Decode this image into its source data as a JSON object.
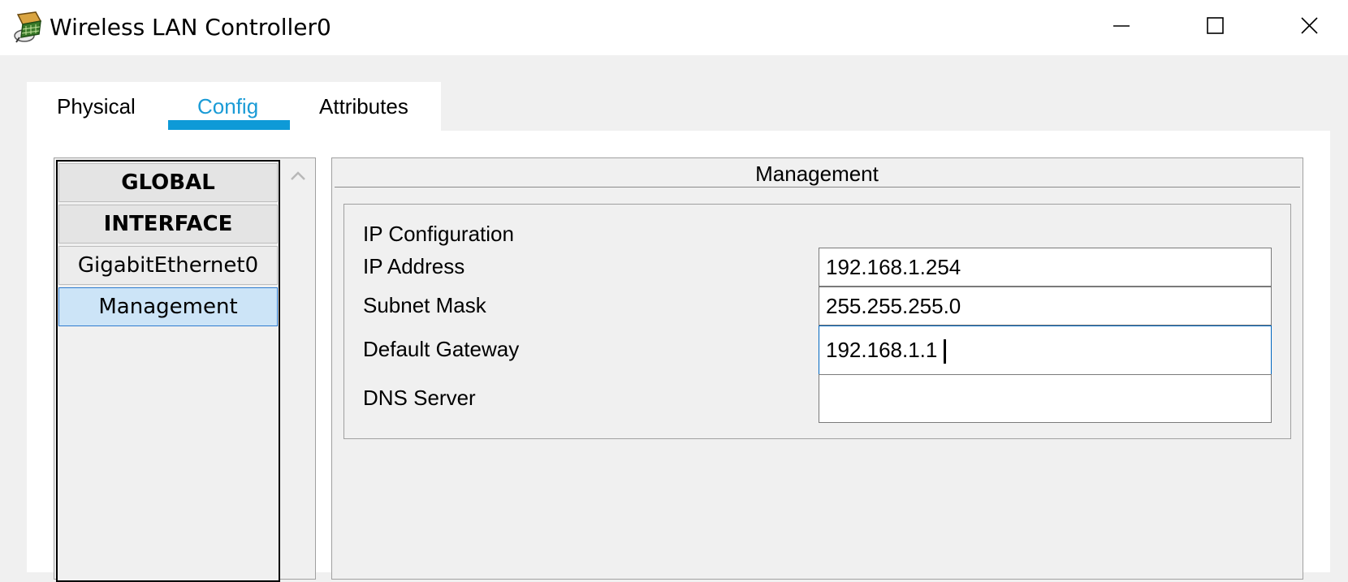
{
  "window": {
    "title": "Wireless LAN Controller0",
    "icon": "wireless-controller-icon",
    "controls": [
      "minimize-icon",
      "maximize-icon",
      "close-icon"
    ]
  },
  "tabs": [
    {
      "label": "Physical",
      "active": false
    },
    {
      "label": "Config",
      "active": true
    },
    {
      "label": "Attributes",
      "active": false
    }
  ],
  "colors": {
    "active_tab_text": "#1a9bd6",
    "active_tab_underline": "#0e9ad7",
    "selected_item_bg": "#cce4f7"
  },
  "sidebar": {
    "items": [
      {
        "label": "GLOBAL",
        "type": "header"
      },
      {
        "label": "INTERFACE",
        "type": "header"
      },
      {
        "label": "GigabitEthernet0",
        "type": "item"
      },
      {
        "label": "Management",
        "type": "item",
        "selected": true
      }
    ]
  },
  "management": {
    "title": "Management",
    "group_label": "IP Configuration",
    "fields": {
      "ip_address": {
        "label": "IP Address",
        "value": "192.168.1.254"
      },
      "subnet_mask": {
        "label": "Subnet Mask",
        "value": "255.255.255.0"
      },
      "default_gateway": {
        "label": "Default Gateway",
        "value": "192.168.1.1",
        "focused": true
      },
      "dns_server": {
        "label": "DNS Server",
        "value": ""
      }
    }
  }
}
